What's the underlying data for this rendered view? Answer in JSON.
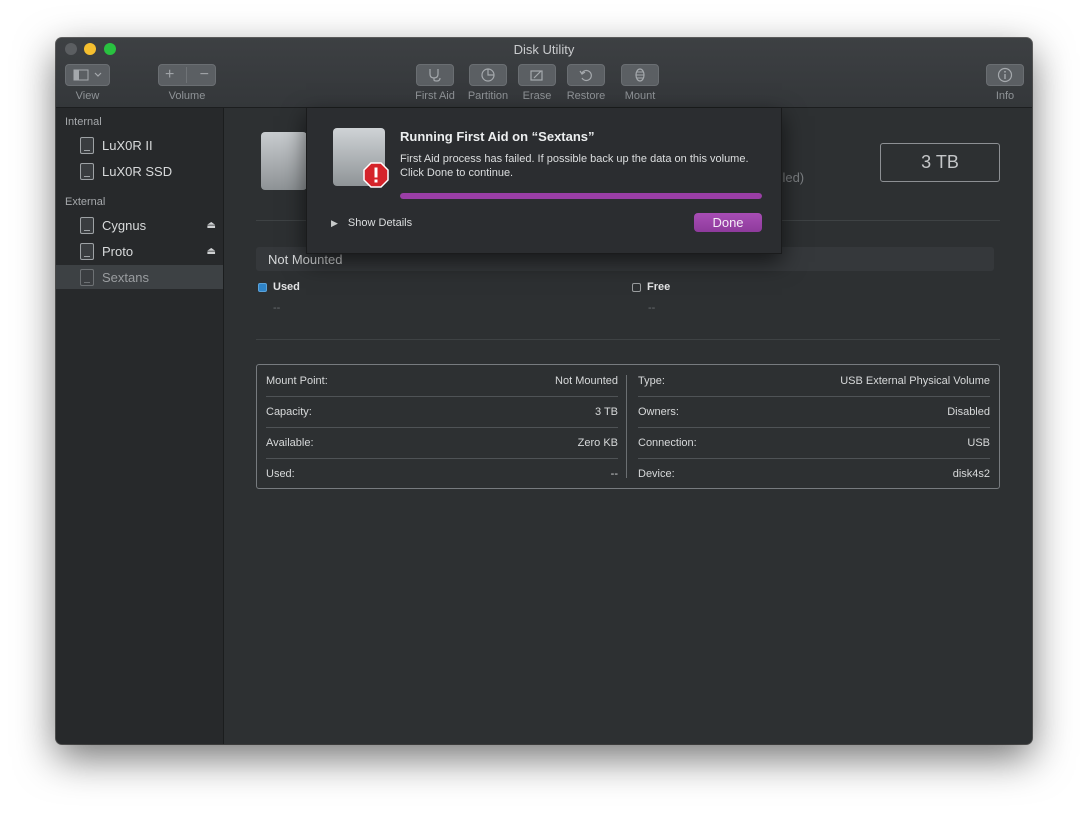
{
  "window": {
    "title": "Disk Utility"
  },
  "toolbar": {
    "view_label": "View",
    "volume_label": "Volume",
    "first_aid_label": "First Aid",
    "partition_label": "Partition",
    "erase_label": "Erase",
    "restore_label": "Restore",
    "mount_label": "Mount",
    "info_label": "Info",
    "add_symbol": "+",
    "remove_symbol": "−"
  },
  "sidebar": {
    "internal_header": "Internal",
    "external_header": "External",
    "internal_items": [
      {
        "label": "LuX0R II"
      },
      {
        "label": "LuX0R SSD"
      }
    ],
    "external_items": [
      {
        "label": "Cygnus"
      },
      {
        "label": "Proto"
      },
      {
        "label": "Sextans"
      }
    ],
    "eject_symbol": "⏏"
  },
  "main": {
    "capacity": "3 TB",
    "partial_subtitle": "abled)",
    "bar_label": "Not Mounted",
    "legend": {
      "used_label": "Used",
      "used_value": "--",
      "free_label": "Free",
      "free_value": "--"
    },
    "info": {
      "left": [
        {
          "key": "Mount Point:",
          "value": "Not Mounted"
        },
        {
          "key": "Capacity:",
          "value": "3 TB"
        },
        {
          "key": "Available:",
          "value": "Zero KB"
        },
        {
          "key": "Used:",
          "value": "--"
        }
      ],
      "right": [
        {
          "key": "Type:",
          "value": "USB External Physical Volume"
        },
        {
          "key": "Owners:",
          "value": "Disabled"
        },
        {
          "key": "Connection:",
          "value": "USB"
        },
        {
          "key": "Device:",
          "value": "disk4s2"
        }
      ]
    }
  },
  "sheet": {
    "title": "Running First Aid on “Sextans”",
    "message": "First Aid process has failed. If possible back up the data on this volume. Click Done to continue.",
    "progress": 1.0,
    "show_details_label": "Show Details",
    "done_label": "Done",
    "accent_color": "#9a3ea6"
  }
}
